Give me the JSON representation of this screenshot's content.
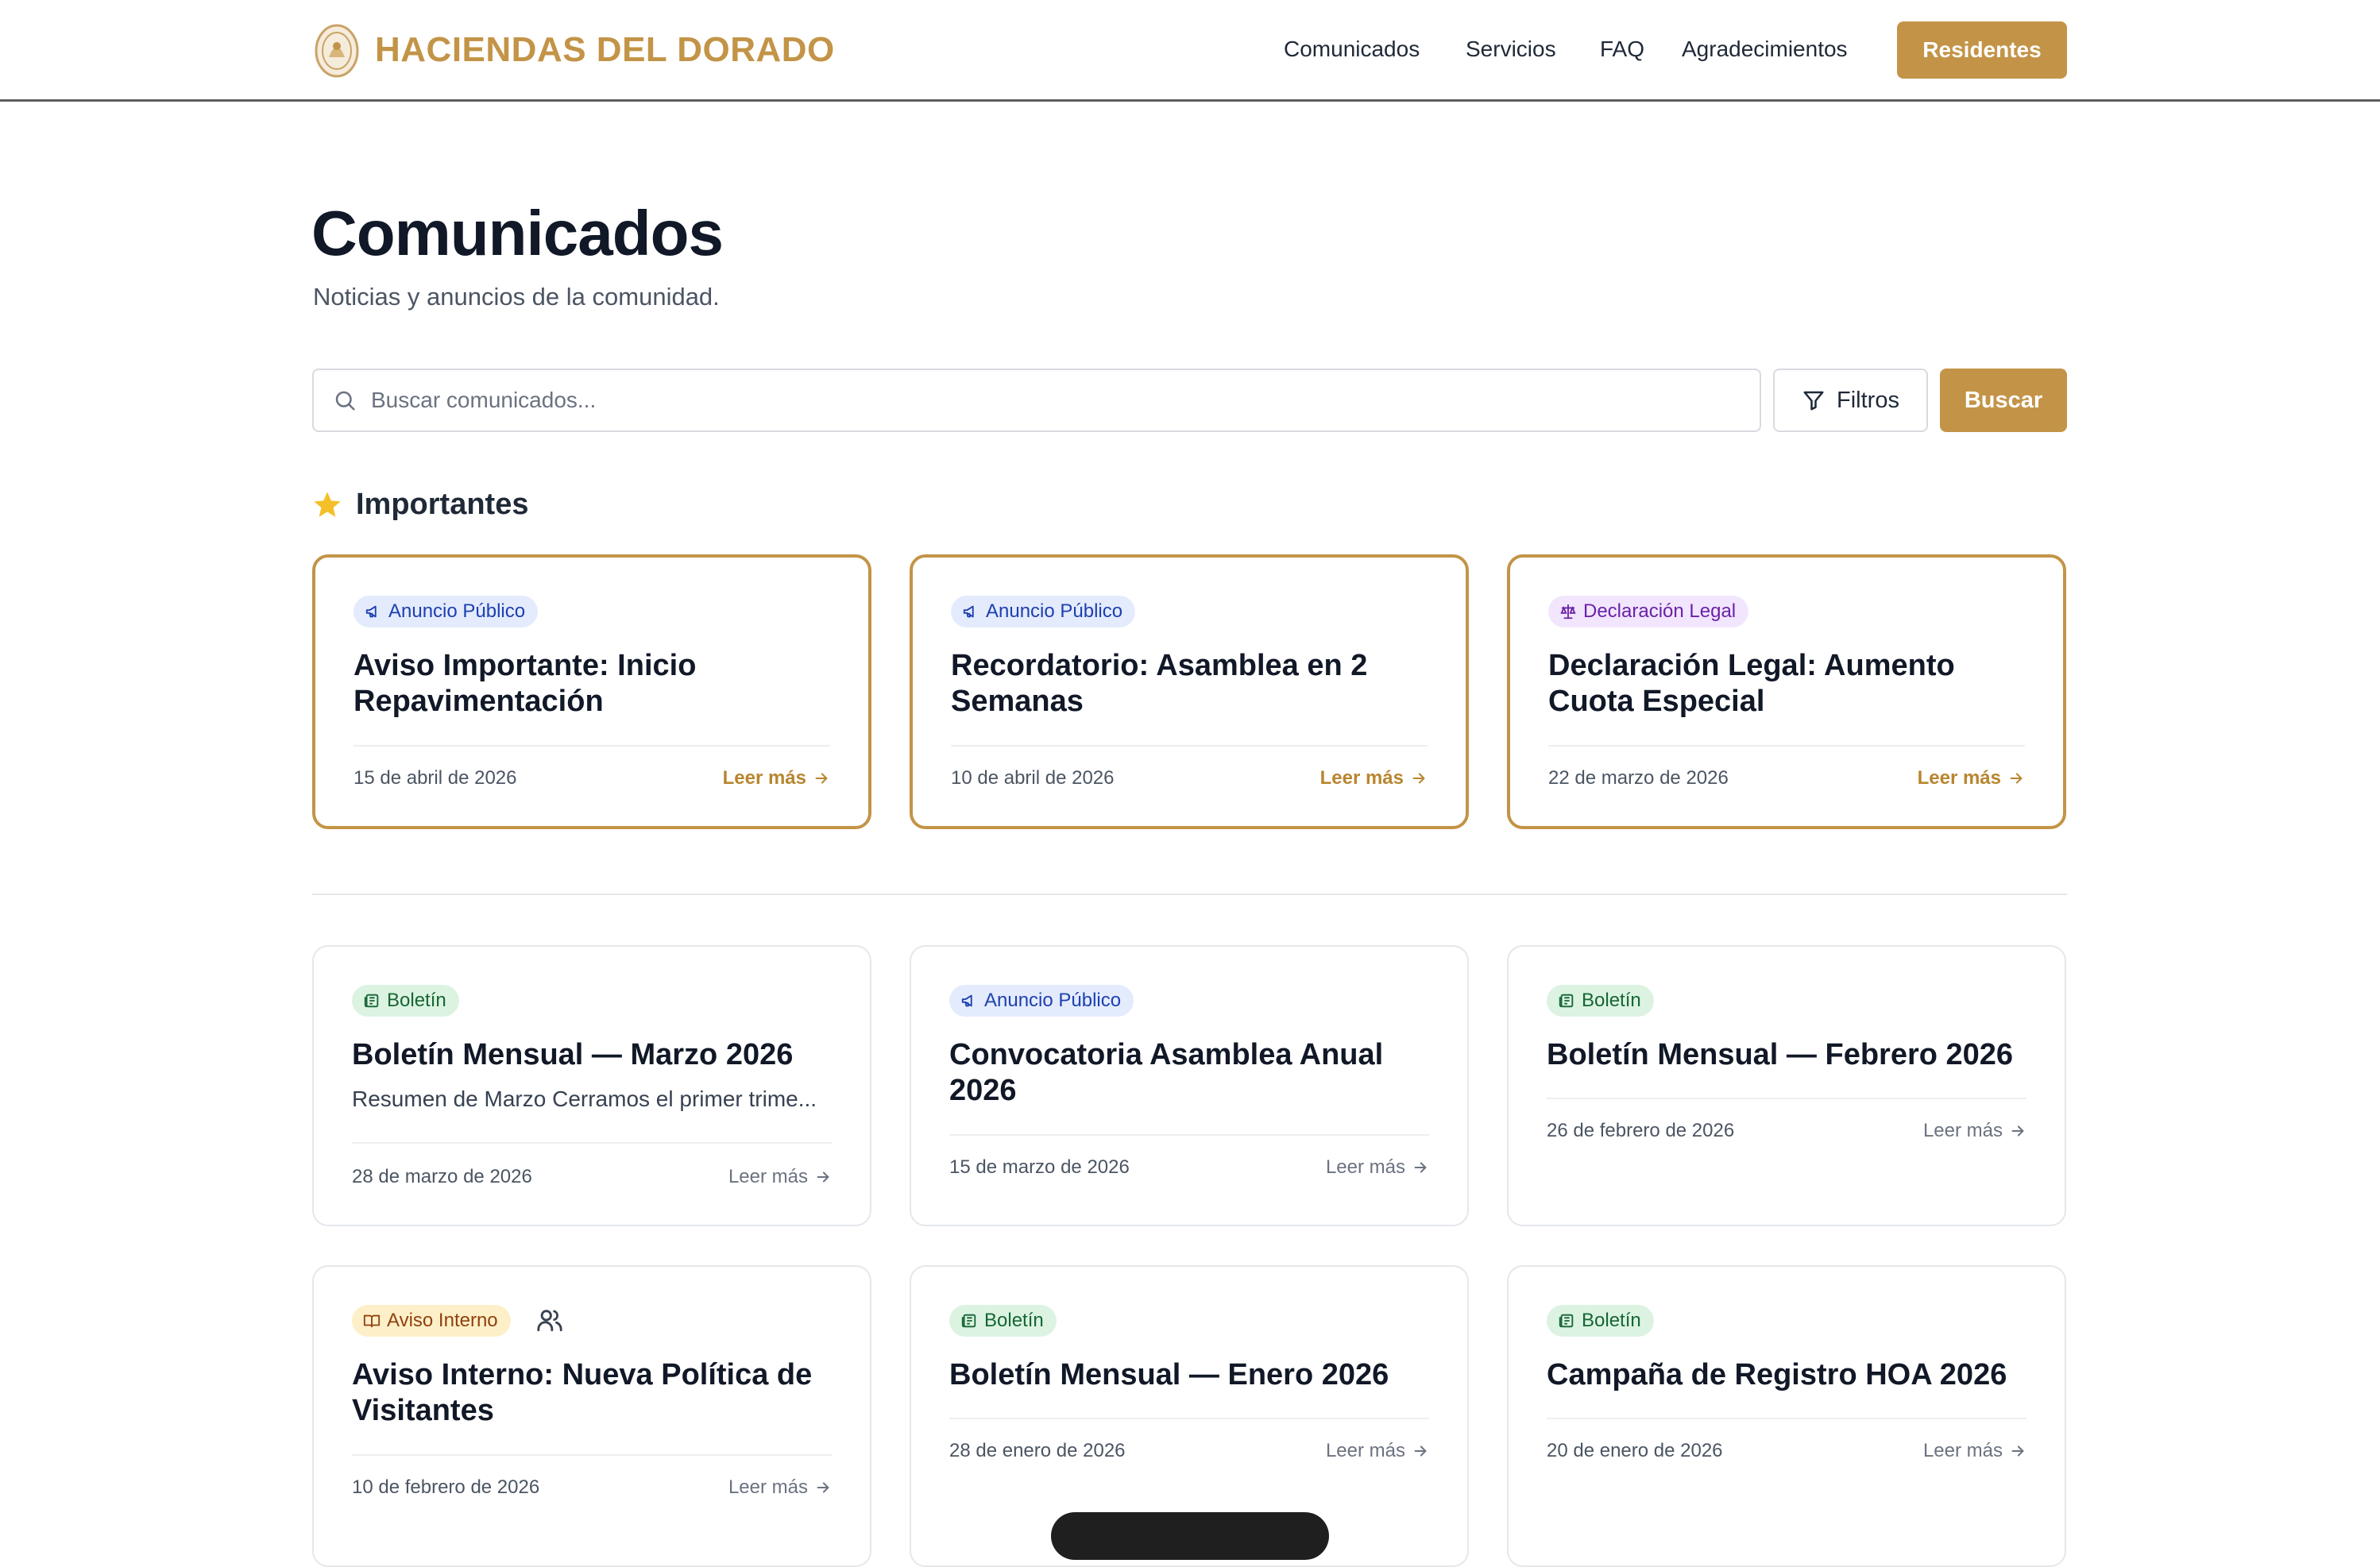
{
  "header": {
    "brand": "HACIENDAS DEL DORADO",
    "nav": [
      "Comunicados",
      "Servicios",
      "FAQ",
      "Agradecimientos"
    ],
    "cta": "Residentes"
  },
  "page": {
    "title": "Comunicados",
    "subtitle": "Noticias y anuncios de la comunidad."
  },
  "search": {
    "placeholder": "Buscar comunicados...",
    "filters_label": "Filtros",
    "submit_label": "Buscar"
  },
  "featured": {
    "heading": "Importantes",
    "cards": [
      {
        "badge": "Anuncio Público",
        "title": "Aviso Importante: Inicio Repavimentación",
        "date": "15 de abril de 2026",
        "cta": "Leer más"
      },
      {
        "badge": "Anuncio Público",
        "title": "Recordatorio: Asamblea en 2 Semanas",
        "date": "10 de abril de 2026",
        "cta": "Leer más"
      },
      {
        "badge": "Declaración Legal",
        "title": "Declaración Legal: Aumento Cuota Especial",
        "date": "22 de marzo de 2026",
        "cta": "Leer más"
      }
    ]
  },
  "posts": [
    {
      "badge": "Boletín",
      "title": "Boletín Mensual — Marzo 2026",
      "excerpt": "Resumen de Marzo Cerramos el primer trime...",
      "date": "28 de marzo de 2026",
      "cta": "Leer más"
    },
    {
      "badge": "Anuncio Público",
      "title": "Convocatoria Asamblea Anual 2026",
      "date": "15 de marzo de 2026",
      "cta": "Leer más"
    },
    {
      "badge": "Boletín",
      "title": "Boletín Mensual — Febrero 2026",
      "date": "26 de febrero de 2026",
      "cta": "Leer más"
    },
    {
      "badge": "Aviso Interno",
      "title": "Aviso Interno: Nueva Política de Visitantes",
      "date": "10 de febrero de 2026",
      "cta": "Leer más"
    },
    {
      "badge": "Boletín",
      "title": "Boletín Mensual — Enero 2026",
      "date": "28 de enero de 2026",
      "cta": "Leer más"
    },
    {
      "badge": "Boletín",
      "title": "Campaña de Registro HOA 2026",
      "date": "20 de enero de 2026",
      "cta": "Leer más"
    }
  ],
  "colors": {
    "brand_gold": "#c39447",
    "badge_publico": "#1e40af",
    "badge_legal": "#6b21a8",
    "badge_boletin": "#166534",
    "badge_interno": "#92400e"
  }
}
